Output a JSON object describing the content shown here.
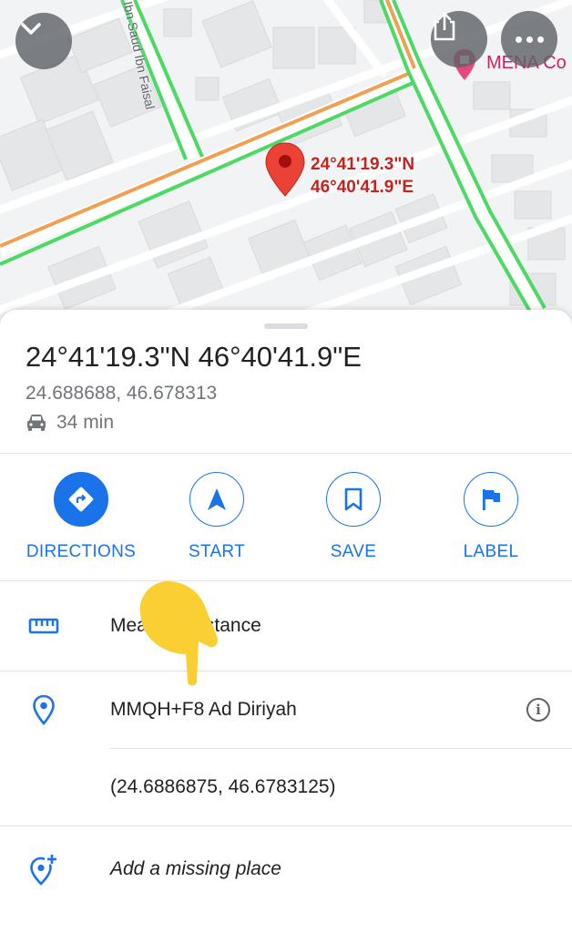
{
  "map": {
    "street_label": "Ibn Saud Ibn Faisal",
    "pin_coords_line1": "24°41'19.3\"N",
    "pin_coords_line2": "46°40'41.9\"E",
    "poi_label": "MENA Co",
    "colors": {
      "pin": "#ea4335",
      "traffic_green": "#4cd964",
      "traffic_orange": "#f0a050"
    }
  },
  "buttons": {
    "collapse_icon": "chevron-down-icon",
    "share_icon": "share-icon",
    "more_icon": "more-icon"
  },
  "place": {
    "title": "24°41'19.3\"N 46°40'41.9\"E",
    "decimal": "24.688688, 46.678313",
    "drive_time": "34 min"
  },
  "actions": [
    {
      "label": "DIRECTIONS",
      "icon": "directions-icon"
    },
    {
      "label": "START",
      "icon": "navigation-arrow-icon"
    },
    {
      "label": "SAVE",
      "icon": "bookmark-icon"
    },
    {
      "label": "LABEL",
      "icon": "flag-icon"
    }
  ],
  "details": {
    "measure": "Measure distance",
    "plus_code": "MMQH+F8 Ad Diriyah",
    "coords_full": "(24.6886875, 46.6783125)",
    "add_place": "Add a missing place"
  },
  "accent_color": "#1a73e8"
}
